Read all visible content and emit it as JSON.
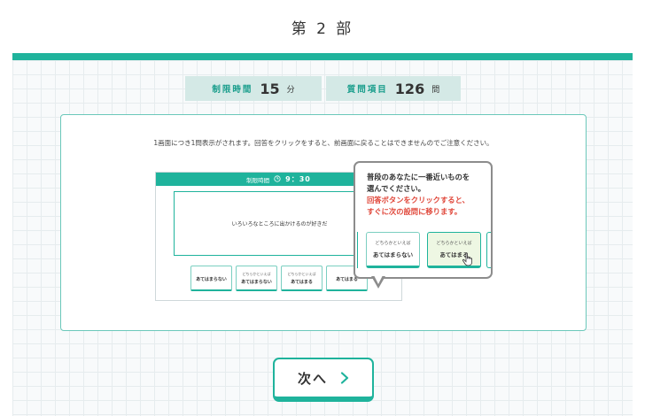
{
  "header": {
    "part_title": "第 2 部"
  },
  "info": {
    "time_label": "制限時間",
    "time_value": "15",
    "time_unit": "分",
    "items_label": "質問項目",
    "items_value": "126",
    "items_unit": "問"
  },
  "instruction": "1画面につき1問表示がされます。回答をクリックをすると、前画面に戻ることはできませんのでご注意ください。",
  "demo": {
    "bar_label": "制限時間",
    "clock_icon": "clock-icon",
    "timer": "9：30",
    "question": "いろいろなところに出かけるのが好きだ",
    "options": [
      {
        "top": "",
        "main": "あてはまらない"
      },
      {
        "top": "どちらかといえば",
        "main": "あてはまらない"
      },
      {
        "top": "どちらかといえば",
        "main": "あてはまる"
      },
      {
        "top": "",
        "main": "あてはまる"
      }
    ]
  },
  "popup": {
    "line1": "普段のあなたに一番近いものを",
    "line2": "選んでください。",
    "line3": "回答ボタンをクリックすると、",
    "line4": "すぐに次の設問に移ります。",
    "options": [
      {
        "top": "どちらかといえば",
        "main": "あてはまらない"
      },
      {
        "top": "どちらかといえば",
        "main": "あてはまる"
      }
    ],
    "accent_color": "#e0473a"
  },
  "next_button": {
    "label": "次へ",
    "icon": "chevron-right-icon"
  },
  "colors": {
    "teal": "#1fb39c",
    "info_bg": "#d4e9e6"
  }
}
